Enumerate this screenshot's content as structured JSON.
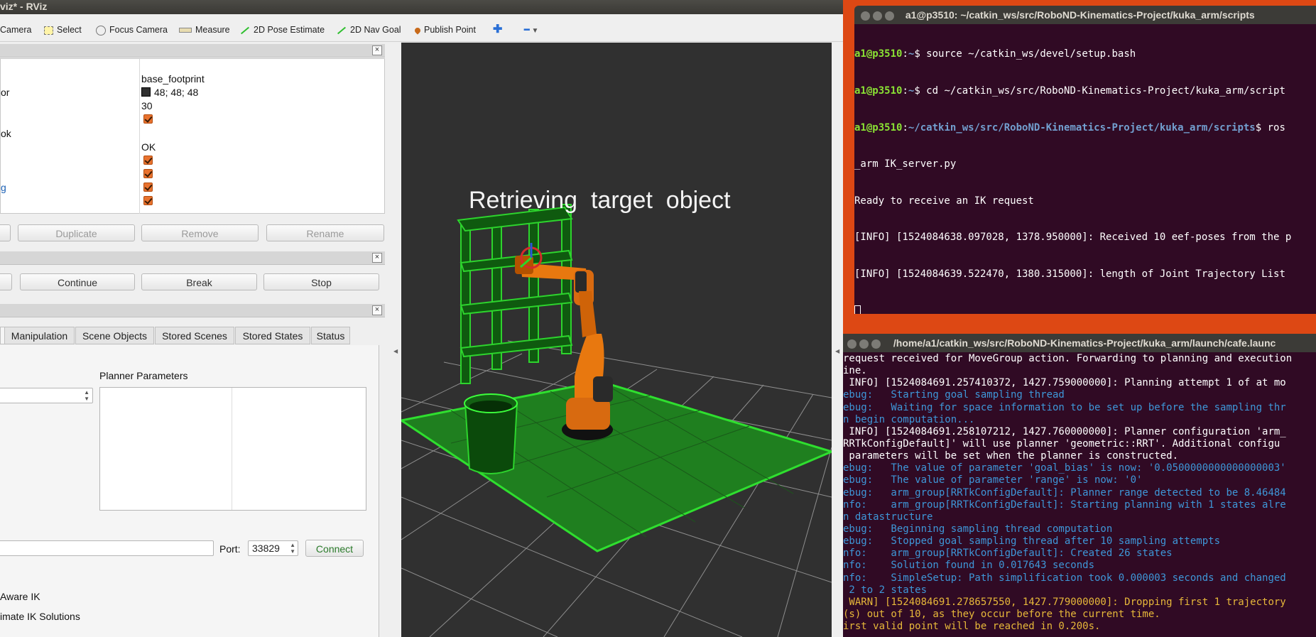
{
  "rviz": {
    "title": "viz* - RViz",
    "toolbar": [
      {
        "label": "Camera",
        "icon": "move-camera-icon"
      },
      {
        "label": "Select",
        "icon": "select-icon"
      },
      {
        "label": "Focus Camera",
        "icon": "focus-camera-icon"
      },
      {
        "label": "Measure",
        "icon": "ruler-icon"
      },
      {
        "label": "2D Pose Estimate",
        "icon": "green-arrow-icon"
      },
      {
        "label": "2D Nav Goal",
        "icon": "green-arrow-icon"
      },
      {
        "label": "Publish Point",
        "icon": "map-pin-icon"
      }
    ],
    "displays": {
      "names": [
        "or",
        "ok",
        "g"
      ],
      "values": {
        "fixed_frame": "base_footprint",
        "background_color": "48; 48; 48",
        "frame_rate": "30",
        "status": "OK"
      },
      "buttons": [
        "Duplicate",
        "Remove",
        "Rename"
      ]
    },
    "tool_panel": {
      "buttons": [
        "Continue",
        "Break",
        "Stop"
      ]
    },
    "motion_planning": {
      "tabs": [
        "Manipulation",
        "Scene Objects",
        "Stored Scenes",
        "Stored States",
        "Status"
      ],
      "planner_params_label": "Planner Parameters",
      "port_label": "Port:",
      "port_value": "33829",
      "connect_label": "Connect",
      "option1": "Aware IK",
      "option2": "imate IK Solutions"
    },
    "viewport": {
      "overlay_text": "Retrieving  target  object"
    }
  },
  "terminal1": {
    "title": "a1@p3510: ~/catkin_ws/src/RoboND-Kinematics-Project/kuka_arm/scripts",
    "lines": [
      {
        "prompt": "a1@p3510",
        "path": "~",
        "cmd": "$ source ~/catkin_ws/devel/setup.bash"
      },
      {
        "prompt": "a1@p3510",
        "path": "~",
        "cmd": "$ cd ~/catkin_ws/src/RoboND-Kinematics-Project/kuka_arm/script"
      },
      {
        "prompt": "a1@p3510",
        "path": "~/catkin_ws/src/RoboND-Kinematics-Project/kuka_arm/scripts",
        "cmd": "$ ros"
      }
    ],
    "output": [
      "_arm IK_server.py",
      "Ready to receive an IK request",
      "[INFO] [1524084638.097028, 1378.950000]: Received 10 eef-poses from the p",
      "[INFO] [1524084639.522470, 1380.315000]: length of Joint Trajectory List"
    ]
  },
  "terminal2": {
    "title": "/home/a1/catkin_ws/src/RoboND-Kinematics-Project/kuka_arm/launch/cafe.launc",
    "lines": [
      {
        "t": "request received for MoveGroup action. Forwarding to planning and execution",
        "c": "w"
      },
      {
        "t": "ine.",
        "c": "w"
      },
      {
        "t": " INFO] [1524084691.257410372, 1427.759000000]: Planning attempt 1 of at mo",
        "c": "w"
      },
      {
        "t": "ebug:   Starting goal sampling thread",
        "c": "d"
      },
      {
        "t": "ebug:   Waiting for space information to be set up before the sampling thr",
        "c": "d"
      },
      {
        "t": "n begin computation...",
        "c": "d"
      },
      {
        "t": " INFO] [1524084691.258107212, 1427.760000000]: Planner configuration 'arm_",
        "c": "w"
      },
      {
        "t": "RRTkConfigDefault]' will use planner 'geometric::RRT'. Additional configu",
        "c": "w"
      },
      {
        "t": " parameters will be set when the planner is constructed.",
        "c": "w"
      },
      {
        "t": "ebug:   The value of parameter 'goal_bias' is now: '0.0500000000000000003'",
        "c": "d"
      },
      {
        "t": "ebug:   The value of parameter 'range' is now: '0'",
        "c": "d"
      },
      {
        "t": "ebug:   arm_group[RRTkConfigDefault]: Planner range detected to be 8.46484",
        "c": "d"
      },
      {
        "t": "nfo:    arm_group[RRTkConfigDefault]: Starting planning with 1 states alre",
        "c": "d"
      },
      {
        "t": "n datastructure",
        "c": "d"
      },
      {
        "t": "ebug:   Beginning sampling thread computation",
        "c": "d"
      },
      {
        "t": "ebug:   Stopped goal sampling thread after 10 sampling attempts",
        "c": "d"
      },
      {
        "t": "nfo:    arm_group[RRTkConfigDefault]: Created 26 states",
        "c": "d"
      },
      {
        "t": "nfo:    Solution found in 0.017643 seconds",
        "c": "d"
      },
      {
        "t": "nfo:    SimpleSetup: Path simplification took 0.000003 seconds and changed",
        "c": "d"
      },
      {
        "t": " 2 to 2 states",
        "c": "d"
      },
      {
        "t": " WARN] [1524084691.278657550, 1427.779000000]: Dropping first 1 trajectory",
        "c": "y"
      },
      {
        "t": "(s) out of 10, as they occur before the current time.",
        "c": "y"
      },
      {
        "t": "irst valid point will be reached in 0.200s.",
        "c": "y"
      }
    ]
  }
}
